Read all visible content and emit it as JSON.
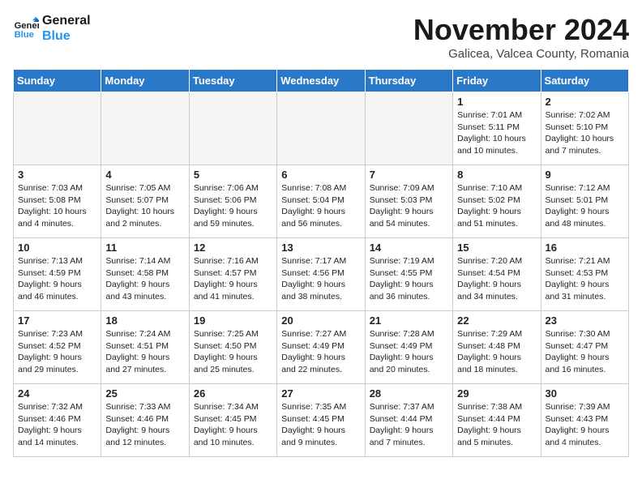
{
  "header": {
    "logo_line1": "General",
    "logo_line2": "Blue",
    "month": "November 2024",
    "location": "Galicea, Valcea County, Romania"
  },
  "weekdays": [
    "Sunday",
    "Monday",
    "Tuesday",
    "Wednesday",
    "Thursday",
    "Friday",
    "Saturday"
  ],
  "weeks": [
    [
      {
        "day": "",
        "info": "",
        "empty": true
      },
      {
        "day": "",
        "info": "",
        "empty": true
      },
      {
        "day": "",
        "info": "",
        "empty": true
      },
      {
        "day": "",
        "info": "",
        "empty": true
      },
      {
        "day": "",
        "info": "",
        "empty": true
      },
      {
        "day": "1",
        "info": "Sunrise: 7:01 AM\nSunset: 5:11 PM\nDaylight: 10 hours and 10 minutes.",
        "empty": false
      },
      {
        "day": "2",
        "info": "Sunrise: 7:02 AM\nSunset: 5:10 PM\nDaylight: 10 hours and 7 minutes.",
        "empty": false
      }
    ],
    [
      {
        "day": "3",
        "info": "Sunrise: 7:03 AM\nSunset: 5:08 PM\nDaylight: 10 hours and 4 minutes.",
        "empty": false
      },
      {
        "day": "4",
        "info": "Sunrise: 7:05 AM\nSunset: 5:07 PM\nDaylight: 10 hours and 2 minutes.",
        "empty": false
      },
      {
        "day": "5",
        "info": "Sunrise: 7:06 AM\nSunset: 5:06 PM\nDaylight: 9 hours and 59 minutes.",
        "empty": false
      },
      {
        "day": "6",
        "info": "Sunrise: 7:08 AM\nSunset: 5:04 PM\nDaylight: 9 hours and 56 minutes.",
        "empty": false
      },
      {
        "day": "7",
        "info": "Sunrise: 7:09 AM\nSunset: 5:03 PM\nDaylight: 9 hours and 54 minutes.",
        "empty": false
      },
      {
        "day": "8",
        "info": "Sunrise: 7:10 AM\nSunset: 5:02 PM\nDaylight: 9 hours and 51 minutes.",
        "empty": false
      },
      {
        "day": "9",
        "info": "Sunrise: 7:12 AM\nSunset: 5:01 PM\nDaylight: 9 hours and 48 minutes.",
        "empty": false
      }
    ],
    [
      {
        "day": "10",
        "info": "Sunrise: 7:13 AM\nSunset: 4:59 PM\nDaylight: 9 hours and 46 minutes.",
        "empty": false
      },
      {
        "day": "11",
        "info": "Sunrise: 7:14 AM\nSunset: 4:58 PM\nDaylight: 9 hours and 43 minutes.",
        "empty": false
      },
      {
        "day": "12",
        "info": "Sunrise: 7:16 AM\nSunset: 4:57 PM\nDaylight: 9 hours and 41 minutes.",
        "empty": false
      },
      {
        "day": "13",
        "info": "Sunrise: 7:17 AM\nSunset: 4:56 PM\nDaylight: 9 hours and 38 minutes.",
        "empty": false
      },
      {
        "day": "14",
        "info": "Sunrise: 7:19 AM\nSunset: 4:55 PM\nDaylight: 9 hours and 36 minutes.",
        "empty": false
      },
      {
        "day": "15",
        "info": "Sunrise: 7:20 AM\nSunset: 4:54 PM\nDaylight: 9 hours and 34 minutes.",
        "empty": false
      },
      {
        "day": "16",
        "info": "Sunrise: 7:21 AM\nSunset: 4:53 PM\nDaylight: 9 hours and 31 minutes.",
        "empty": false
      }
    ],
    [
      {
        "day": "17",
        "info": "Sunrise: 7:23 AM\nSunset: 4:52 PM\nDaylight: 9 hours and 29 minutes.",
        "empty": false
      },
      {
        "day": "18",
        "info": "Sunrise: 7:24 AM\nSunset: 4:51 PM\nDaylight: 9 hours and 27 minutes.",
        "empty": false
      },
      {
        "day": "19",
        "info": "Sunrise: 7:25 AM\nSunset: 4:50 PM\nDaylight: 9 hours and 25 minutes.",
        "empty": false
      },
      {
        "day": "20",
        "info": "Sunrise: 7:27 AM\nSunset: 4:49 PM\nDaylight: 9 hours and 22 minutes.",
        "empty": false
      },
      {
        "day": "21",
        "info": "Sunrise: 7:28 AM\nSunset: 4:49 PM\nDaylight: 9 hours and 20 minutes.",
        "empty": false
      },
      {
        "day": "22",
        "info": "Sunrise: 7:29 AM\nSunset: 4:48 PM\nDaylight: 9 hours and 18 minutes.",
        "empty": false
      },
      {
        "day": "23",
        "info": "Sunrise: 7:30 AM\nSunset: 4:47 PM\nDaylight: 9 hours and 16 minutes.",
        "empty": false
      }
    ],
    [
      {
        "day": "24",
        "info": "Sunrise: 7:32 AM\nSunset: 4:46 PM\nDaylight: 9 hours and 14 minutes.",
        "empty": false
      },
      {
        "day": "25",
        "info": "Sunrise: 7:33 AM\nSunset: 4:46 PM\nDaylight: 9 hours and 12 minutes.",
        "empty": false
      },
      {
        "day": "26",
        "info": "Sunrise: 7:34 AM\nSunset: 4:45 PM\nDaylight: 9 hours and 10 minutes.",
        "empty": false
      },
      {
        "day": "27",
        "info": "Sunrise: 7:35 AM\nSunset: 4:45 PM\nDaylight: 9 hours and 9 minutes.",
        "empty": false
      },
      {
        "day": "28",
        "info": "Sunrise: 7:37 AM\nSunset: 4:44 PM\nDaylight: 9 hours and 7 minutes.",
        "empty": false
      },
      {
        "day": "29",
        "info": "Sunrise: 7:38 AM\nSunset: 4:44 PM\nDaylight: 9 hours and 5 minutes.",
        "empty": false
      },
      {
        "day": "30",
        "info": "Sunrise: 7:39 AM\nSunset: 4:43 PM\nDaylight: 9 hours and 4 minutes.",
        "empty": false
      }
    ]
  ]
}
